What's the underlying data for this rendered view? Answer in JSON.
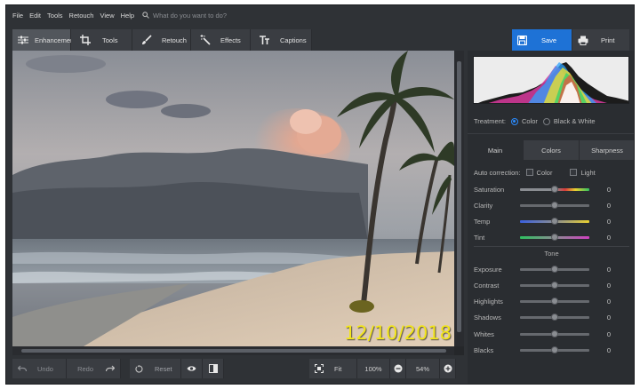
{
  "menu": [
    "File",
    "Edit",
    "Tools",
    "Retouch",
    "View",
    "Help"
  ],
  "search": {
    "placeholder": "What do you want to do?"
  },
  "toolbar": {
    "tabs": [
      {
        "label": "Enhancement",
        "icon": "sliders-icon",
        "active": true
      },
      {
        "label": "Tools",
        "icon": "crop-icon"
      },
      {
        "label": "Retouch",
        "icon": "brush-icon"
      },
      {
        "label": "Effects",
        "icon": "magic-wand-icon"
      },
      {
        "label": "Captions",
        "icon": "text-icon"
      }
    ],
    "save_label": "Save",
    "print_label": "Print"
  },
  "photo": {
    "date_stamp": "12/10/2018"
  },
  "bottom": {
    "undo_label": "Undo",
    "redo_label": "Redo",
    "reset_label": "Reset",
    "fit_label": "Fit",
    "zoom_100_label": "100%",
    "zoom_value": "54%"
  },
  "panel": {
    "treatment_label": "Treatment:",
    "treatment_options": [
      "Color",
      "Black & White"
    ],
    "treatment_selected": "Color",
    "subtabs": [
      "Main",
      "Colors",
      "Sharpness"
    ],
    "auto_correction": {
      "label": "Auto correction:",
      "options": [
        "Color",
        "Light"
      ]
    },
    "sliders_top": [
      {
        "name": "Saturation",
        "value": "0",
        "gradient": "saturation"
      },
      {
        "name": "Clarity",
        "value": "0",
        "gradient": "gray"
      },
      {
        "name": "Temp",
        "value": "0",
        "gradient": "temp"
      },
      {
        "name": "Tint",
        "value": "0",
        "gradient": "tint"
      }
    ],
    "tone_title": "Tone",
    "sliders_tone": [
      {
        "name": "Exposure",
        "value": "0"
      },
      {
        "name": "Contrast",
        "value": "0"
      },
      {
        "name": "Highlights",
        "value": "0"
      },
      {
        "name": "Shadows",
        "value": "0"
      },
      {
        "name": "Whites",
        "value": "0"
      },
      {
        "name": "Blacks",
        "value": "0"
      }
    ]
  },
  "colors": {
    "accent": "#1e72d6",
    "date_stamp": "#f2e51b",
    "panel_bg": "#2a2d31"
  }
}
